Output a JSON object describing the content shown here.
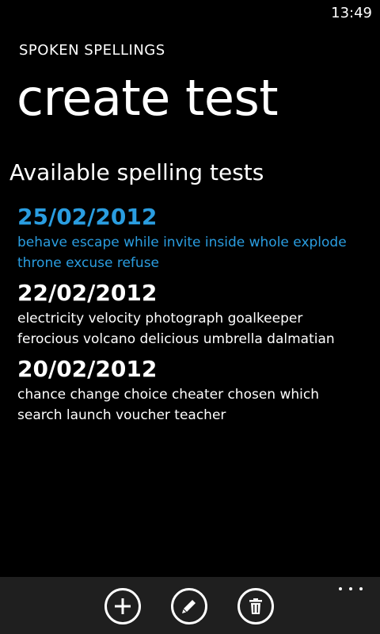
{
  "status_bar": {
    "time": "13:49"
  },
  "header": {
    "app_title": "SPOKEN SPELLINGS",
    "page_title": "create test"
  },
  "section": {
    "heading": "Available spelling tests"
  },
  "tests": [
    {
      "date": "25/02/2012",
      "words": "behave escape while invite inside whole explode throne excuse refuse",
      "selected": true
    },
    {
      "date": "22/02/2012",
      "words": "electricity velocity photograph goalkeeper ferocious volcano delicious umbrella dalmatian",
      "selected": false
    },
    {
      "date": "20/02/2012",
      "words": "chance change choice cheater chosen which search launch voucher teacher",
      "selected": false
    }
  ],
  "app_bar": {
    "buttons": [
      {
        "icon": "add-icon"
      },
      {
        "icon": "edit-icon"
      },
      {
        "icon": "delete-icon"
      }
    ],
    "more_icon": "more-icon"
  },
  "colors": {
    "background": "#000000",
    "accent": "#2a9de0",
    "app_bar": "#1f1f1f",
    "text": "#ffffff"
  }
}
